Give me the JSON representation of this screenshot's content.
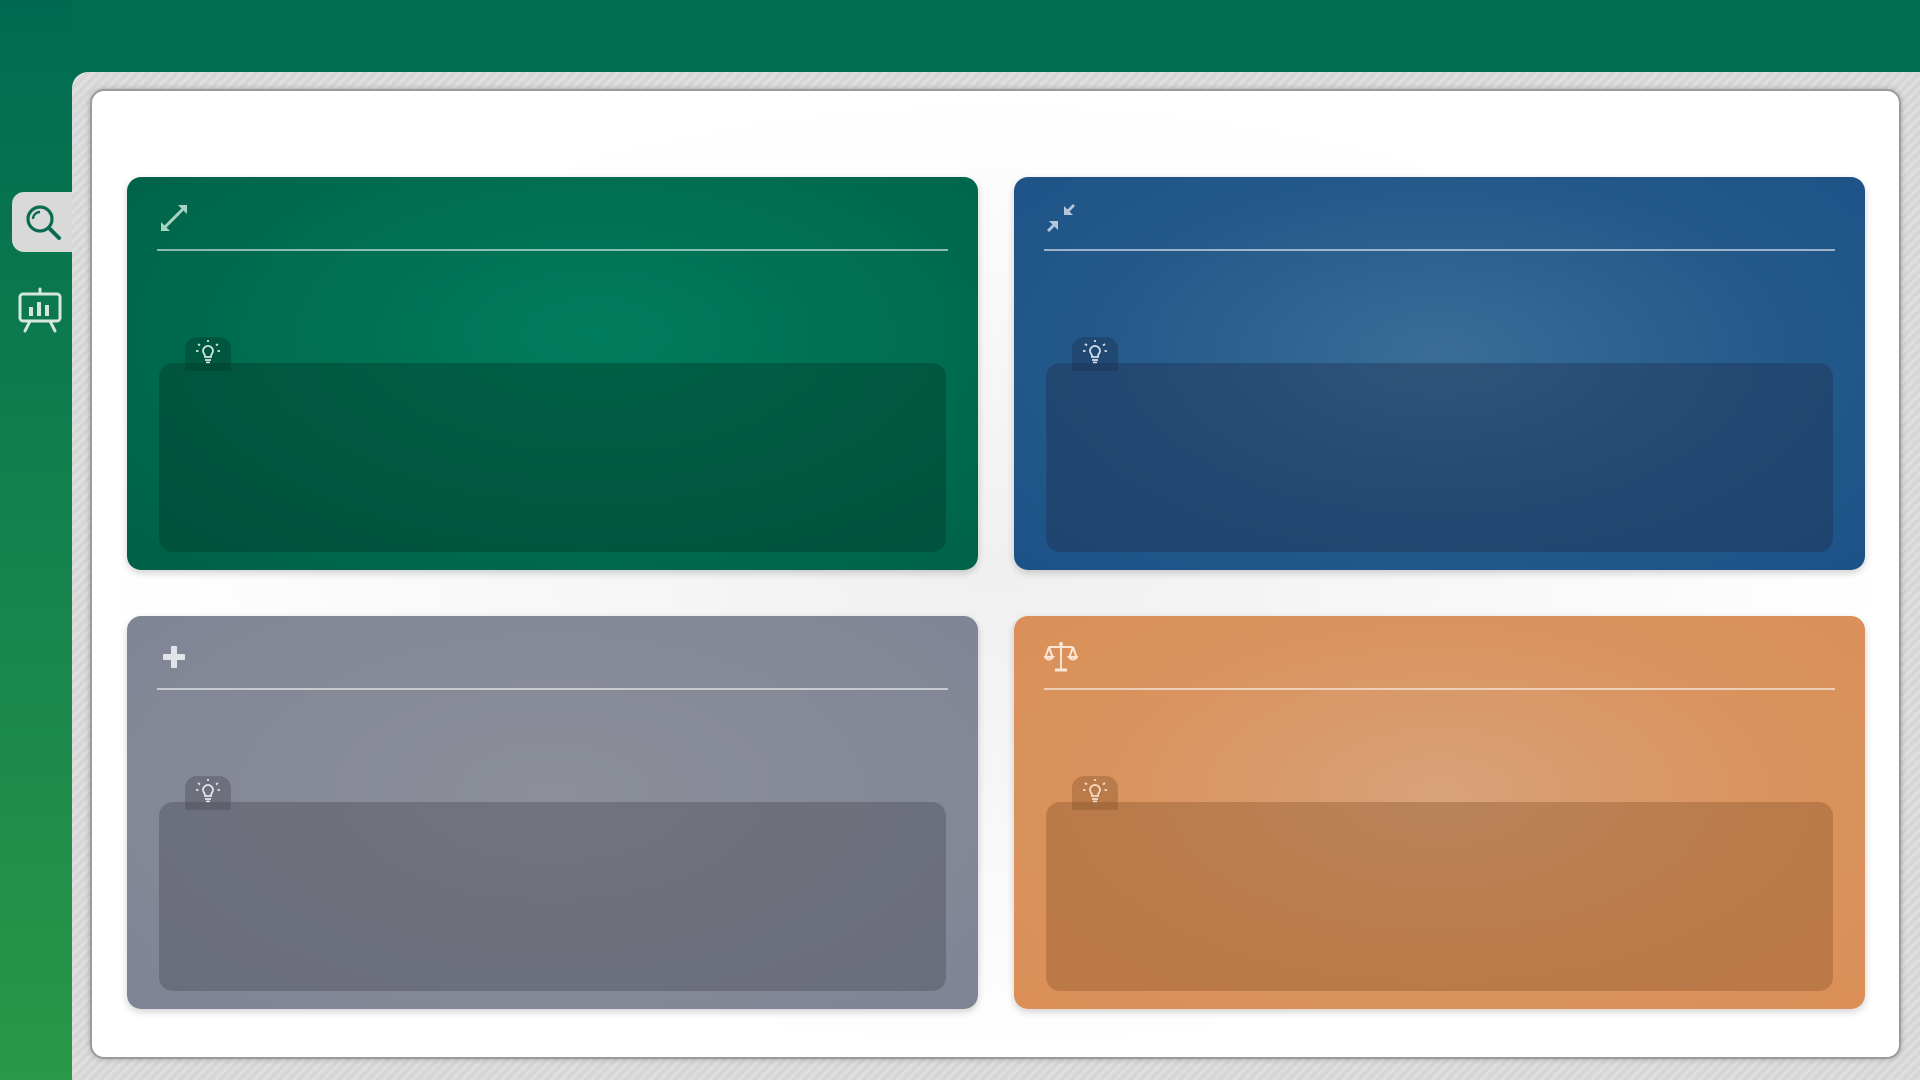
{
  "sidebar": {
    "items": [
      {
        "icon": "magnifier-icon",
        "label": "",
        "active": true
      },
      {
        "icon": "presentation-chart-icon",
        "label": "",
        "active": false
      }
    ]
  },
  "slide": {
    "cards": [
      {
        "id": "green",
        "icon": "expand-arrows-icon",
        "title": "",
        "body": "",
        "note_icon": "lightbulb-icon",
        "note": "",
        "color": "#006a4e"
      },
      {
        "id": "blue",
        "icon": "compress-arrows-icon",
        "title": "",
        "body": "",
        "note_icon": "lightbulb-icon",
        "note": "",
        "color": "#1c5286"
      },
      {
        "id": "grey",
        "icon": "plus-icon",
        "title": "",
        "body": "",
        "note_icon": "lightbulb-icon",
        "note": "",
        "color": "#7f8495"
      },
      {
        "id": "orange",
        "icon": "balance-scale-icon",
        "title": "",
        "body": "",
        "note_icon": "lightbulb-icon",
        "note": "",
        "color": "#db8f56"
      }
    ]
  },
  "colors": {
    "brand_green": "#006c50",
    "frame_grey": "#d6d6d6",
    "slide_white": "#ffffff"
  }
}
